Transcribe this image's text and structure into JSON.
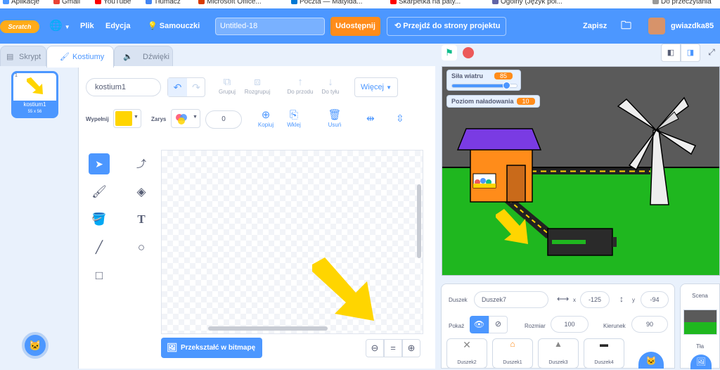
{
  "bookmarks": [
    "Aplikacje",
    "Gmail",
    "YouTube",
    "Tłumacz",
    "Microsoft Office...",
    "Poczta — Matylda...",
    "Skarpetka na paty...",
    "Ogólny (Język pol...",
    "Do przeczytania"
  ],
  "menu": {
    "logo": "Scratch",
    "file": "Plik",
    "edit": "Edycja",
    "tutorials": "Samouczki",
    "project_title": "Untitled-18",
    "share": "Udostępnij",
    "see_project": "Przejdź do strony projektu",
    "save": "Zapisz",
    "username": "gwiazdka85"
  },
  "tabs": {
    "code": "Skrypt",
    "costumes": "Kostiumy",
    "sounds": "Dźwięki"
  },
  "costume_list": [
    {
      "index": "1",
      "name": "kostium1",
      "size": "55 x 56"
    }
  ],
  "editor": {
    "costume_name": "kostium1",
    "group": "Grupuj",
    "ungroup": "Rozgrupuj",
    "forward": "Do przodu",
    "backward": "Do tyłu",
    "more": "Więcej",
    "fill_label": "Wypełnij",
    "outline_label": "Zarys",
    "outline_width": "0",
    "copy": "Kopiuj",
    "paste": "Wklej",
    "delete": "Usuń",
    "convert_bitmap": "Przekształć w bitmapę",
    "zoom_reset": "="
  },
  "stage": {
    "monitors": [
      {
        "label": "Siła wiatru",
        "value": "85",
        "slider_fraction": 0.85
      },
      {
        "label": "Poziom naładowania",
        "value": "10"
      }
    ]
  },
  "sprite_info": {
    "sprite_label": "Duszek",
    "sprite_name": "Duszek7",
    "x_label": "x",
    "x_value": "-125",
    "y_label": "y",
    "y_value": "-94",
    "show_label": "Pokaż",
    "size_label": "Rozmiar",
    "size_value": "100",
    "direction_label": "Kierunek",
    "direction_value": "90"
  },
  "sprites": [
    "Duszek2",
    "Duszek1",
    "Duszek3",
    "Duszek4"
  ],
  "scene": {
    "title": "Scena",
    "backdrops_label": "Tła"
  },
  "colors": {
    "accent": "#4c97ff",
    "share": "#ff8c1a",
    "fill": "#ffd500",
    "stage_grass": "#1fb71f",
    "stage_sky": "#5a5a5a"
  }
}
